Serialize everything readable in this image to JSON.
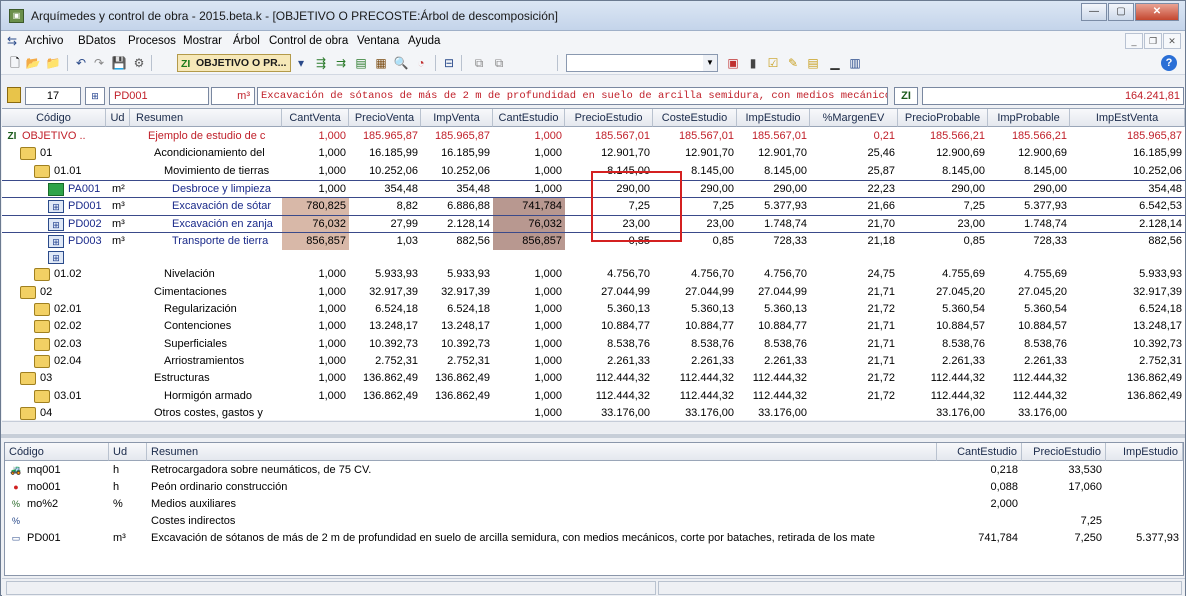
{
  "window": {
    "title": "Arquímedes y control de obra - 2015.beta.k - [OBJETIVO O PRECOSTE:Árbol de descomposición]",
    "app_icon": "arquimedes-app-icon"
  },
  "menu": [
    "Archivo",
    "BDatos",
    "Procesos",
    "Mostrar",
    "Árbol",
    "Control de obra",
    "Ventana",
    "Ayuda"
  ],
  "toolbar": {
    "active_document": "OBJETIVO O PR...",
    "active_document_icon": "ZI"
  },
  "nav": {
    "level": "17",
    "code": "PD001",
    "unit": "m³",
    "description": "Excavación de sótanos de más de 2 m de profundidad en suelo de arcilla semidura, con medios mecánicos, corte por batac",
    "total": "164.241,81"
  },
  "grid": {
    "columns": [
      "Código",
      "Ud",
      "Resumen",
      "CantVenta",
      "PrecioVenta",
      "ImpVenta",
      "CantEstudio",
      "PrecioEstudio",
      "CosteEstudio",
      "ImpEstudio",
      "%MargenEV",
      "PrecioProbable",
      "ImpProbable",
      "ImpEstVenta"
    ],
    "rows": [
      {
        "code": "OBJETIVO ..",
        "ud": "",
        "resumen": "Ejemplo de estudio de c",
        "cv": "1,000",
        "pv": "185.965,87",
        "iv": "185.965,87",
        "ce": "1,000",
        "pe": "185.567,01",
        "cse": "185.567,01",
        "ie": "185.567,01",
        "m": "0,21",
        "pp": "185.566,21",
        "ip": "185.566,21",
        "iev": "185.965,87"
      },
      {
        "code": "01",
        "ud": "",
        "resumen": "Acondicionamiento del",
        "cv": "1,000",
        "pv": "16.185,99",
        "iv": "16.185,99",
        "ce": "1,000",
        "pe": "12.901,70",
        "cse": "12.901,70",
        "ie": "12.901,70",
        "m": "25,46",
        "pp": "12.900,69",
        "ip": "12.900,69",
        "iev": "16.185,99"
      },
      {
        "code": "01.01",
        "ud": "",
        "resumen": "Movimiento de tierras",
        "cv": "1,000",
        "pv": "10.252,06",
        "iv": "10.252,06",
        "ce": "1,000",
        "pe": "8.145,00",
        "cse": "8.145,00",
        "ie": "8.145,00",
        "m": "25,87",
        "pp": "8.145,00",
        "ip": "8.145,00",
        "iev": "10.252,06"
      },
      {
        "code": "PA001",
        "ud": "m²",
        "resumen": "Desbroce y limpieza",
        "cv": "1,000",
        "pv": "354,48",
        "iv": "354,48",
        "ce": "1,000",
        "pe": "290,00",
        "cse": "290,00",
        "ie": "290,00",
        "m": "22,23",
        "pp": "290,00",
        "ip": "290,00",
        "iev": "354,48"
      },
      {
        "code": "PD001",
        "ud": "m³",
        "resumen": "Excavación de sótar",
        "cv": "780,825",
        "pv": "8,82",
        "iv": "6.886,88",
        "ce": "741,784",
        "pe": "7,25",
        "cse": "7,25",
        "ie": "5.377,93",
        "m": "21,66",
        "pp": "7,25",
        "ip": "5.377,93",
        "iev": "6.542,53"
      },
      {
        "code": "PD002",
        "ud": "m³",
        "resumen": "Excavación en zanja",
        "cv": "76,032",
        "pv": "27,99",
        "iv": "2.128,14",
        "ce": "76,032",
        "pe": "23,00",
        "cse": "23,00",
        "ie": "1.748,74",
        "m": "21,70",
        "pp": "23,00",
        "ip": "1.748,74",
        "iev": "2.128,14"
      },
      {
        "code": "PD003",
        "ud": "m³",
        "resumen": "Transporte de tierra",
        "cv": "856,857",
        "pv": "1,03",
        "iv": "882,56",
        "ce": "856,857",
        "pe": "0,85",
        "cse": "0,85",
        "ie": "728,33",
        "m": "21,18",
        "pp": "0,85",
        "ip": "728,33",
        "iev": "882,56"
      },
      {
        "code": "",
        "ud": "",
        "resumen": "",
        "cv": "",
        "pv": "",
        "iv": "",
        "ce": "",
        "pe": "",
        "cse": "",
        "ie": "",
        "m": "",
        "pp": "",
        "ip": "",
        "iev": ""
      },
      {
        "code": "01.02",
        "ud": "",
        "resumen": "Nivelación",
        "cv": "1,000",
        "pv": "5.933,93",
        "iv": "5.933,93",
        "ce": "1,000",
        "pe": "4.756,70",
        "cse": "4.756,70",
        "ie": "4.756,70",
        "m": "24,75",
        "pp": "4.755,69",
        "ip": "4.755,69",
        "iev": "5.933,93"
      },
      {
        "code": "02",
        "ud": "",
        "resumen": "Cimentaciones",
        "cv": "1,000",
        "pv": "32.917,39",
        "iv": "32.917,39",
        "ce": "1,000",
        "pe": "27.044,99",
        "cse": "27.044,99",
        "ie": "27.044,99",
        "m": "21,71",
        "pp": "27.045,20",
        "ip": "27.045,20",
        "iev": "32.917,39"
      },
      {
        "code": "02.01",
        "ud": "",
        "resumen": "Regularización",
        "cv": "1,000",
        "pv": "6.524,18",
        "iv": "6.524,18",
        "ce": "1,000",
        "pe": "5.360,13",
        "cse": "5.360,13",
        "ie": "5.360,13",
        "m": "21,72",
        "pp": "5.360,54",
        "ip": "5.360,54",
        "iev": "6.524,18"
      },
      {
        "code": "02.02",
        "ud": "",
        "resumen": "Contenciones",
        "cv": "1,000",
        "pv": "13.248,17",
        "iv": "13.248,17",
        "ce": "1,000",
        "pe": "10.884,77",
        "cse": "10.884,77",
        "ie": "10.884,77",
        "m": "21,71",
        "pp": "10.884,57",
        "ip": "10.884,57",
        "iev": "13.248,17"
      },
      {
        "code": "02.03",
        "ud": "",
        "resumen": "Superficiales",
        "cv": "1,000",
        "pv": "10.392,73",
        "iv": "10.392,73",
        "ce": "1,000",
        "pe": "8.538,76",
        "cse": "8.538,76",
        "ie": "8.538,76",
        "m": "21,71",
        "pp": "8.538,76",
        "ip": "8.538,76",
        "iev": "10.392,73"
      },
      {
        "code": "02.04",
        "ud": "",
        "resumen": "Arriostramientos",
        "cv": "1,000",
        "pv": "2.752,31",
        "iv": "2.752,31",
        "ce": "1,000",
        "pe": "2.261,33",
        "cse": "2.261,33",
        "ie": "2.261,33",
        "m": "21,71",
        "pp": "2.261,33",
        "ip": "2.261,33",
        "iev": "2.752,31"
      },
      {
        "code": "03",
        "ud": "",
        "resumen": "Estructuras",
        "cv": "1,000",
        "pv": "136.862,49",
        "iv": "136.862,49",
        "ce": "1,000",
        "pe": "112.444,32",
        "cse": "112.444,32",
        "ie": "112.444,32",
        "m": "21,72",
        "pp": "112.444,32",
        "ip": "112.444,32",
        "iev": "136.862,49"
      },
      {
        "code": "03.01",
        "ud": "",
        "resumen": "Hormigón armado",
        "cv": "1,000",
        "pv": "136.862,49",
        "iv": "136.862,49",
        "ce": "1,000",
        "pe": "112.444,32",
        "cse": "112.444,32",
        "ie": "112.444,32",
        "m": "21,72",
        "pp": "112.444,32",
        "ip": "112.444,32",
        "iev": "136.862,49"
      },
      {
        "code": "04",
        "ud": "",
        "resumen": "Otros costes, gastos y",
        "cv": "",
        "pv": "",
        "iv": "",
        "ce": "1,000",
        "pe": "33.176,00",
        "cse": "33.176,00",
        "ie": "33.176,00",
        "m": "",
        "pp": "33.176,00",
        "ip": "33.176,00",
        "iev": ""
      }
    ]
  },
  "bottom": {
    "columns": [
      "Código",
      "Ud",
      "Resumen",
      "CantEstudio",
      "PrecioEstudio",
      "ImpEstudio"
    ],
    "rows": [
      {
        "code": "mq001",
        "ud": "h",
        "resumen": "Retrocargadora sobre neumáticos, de 75 CV.",
        "ce": "0,218",
        "pe": "33,530",
        "ie": ""
      },
      {
        "code": "mo001",
        "ud": "h",
        "resumen": "Peón ordinario construcción",
        "ce": "0,088",
        "pe": "17,060",
        "ie": ""
      },
      {
        "code": "mo%2",
        "ud": "%",
        "resumen": "Medios auxiliares",
        "ce": "2,000",
        "pe": "",
        "ie": ""
      },
      {
        "code": "",
        "ud": "",
        "resumen": "Costes indirectos",
        "ce": "",
        "pe": "7,25",
        "ie": ""
      },
      {
        "code": "PD001",
        "ud": "m³",
        "resumen": "Excavación de sótanos de más de 2 m de profundidad en suelo de arcilla semidura, con medios mecánicos, corte por bataches, retirada de los mate",
        "ce": "741,784",
        "pe": "7,250",
        "ie": "5.377,93"
      }
    ]
  },
  "colors": {
    "accent_red": "#c0202a",
    "selection": "#d42020",
    "highlight": "#d8b8a8"
  }
}
